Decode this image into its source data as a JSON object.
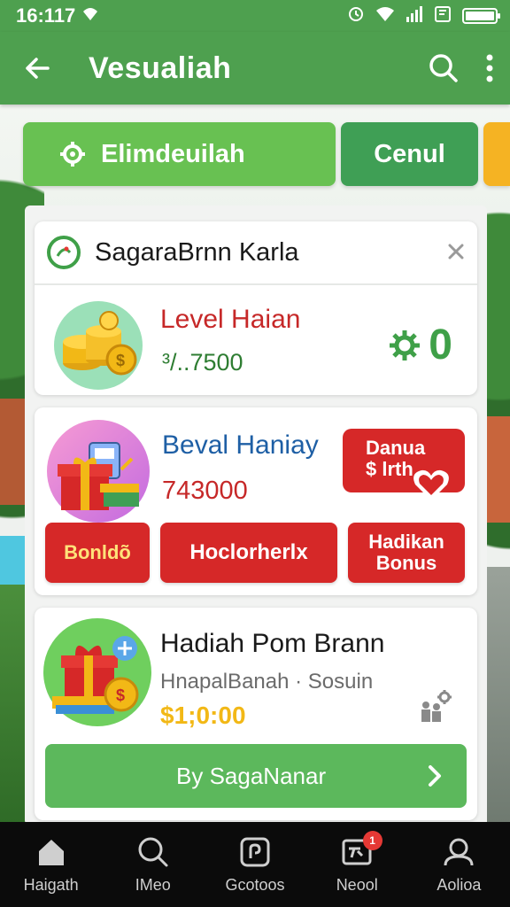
{
  "status_bar": {
    "time": "16:117"
  },
  "app_bar": {
    "title": "Vesualiah"
  },
  "tabs": [
    {
      "label": "Elimdeuilah"
    },
    {
      "label": "Cenul"
    },
    {
      "label": ""
    }
  ],
  "card1": {
    "title": "SagaraBrnn Karla",
    "level": "Level Haian",
    "amount": "³/..7500",
    "score": "0"
  },
  "card2": {
    "title": "Beval Haniay",
    "amount": "743000",
    "badge_line1": "Danua",
    "badge_line2": "$ lrth",
    "buttons": [
      "Bonldõ",
      "Hoclorherlx",
      "Hadikan Bonus"
    ]
  },
  "card3": {
    "title": "Hadiah Pom Brann",
    "subtitle": "HnapalBanah · Sosuin",
    "amount": "$1;0:00",
    "action_label": "By SagaNanar"
  },
  "bottom_nav": {
    "items": [
      {
        "label": "Haigath",
        "icon": "home-icon"
      },
      {
        "label": "IMeo",
        "icon": "search-icon"
      },
      {
        "label": "Gcotoos",
        "icon": "map-pin-icon"
      },
      {
        "label": "Neool",
        "icon": "inbox-icon",
        "badge": "1"
      },
      {
        "label": "Aolioa",
        "icon": "profile-icon"
      }
    ]
  },
  "colors": {
    "primary_green": "#4ea04f",
    "light_green": "#68c152",
    "accent_red": "#d62828",
    "accent_yellow": "#f5b323"
  }
}
